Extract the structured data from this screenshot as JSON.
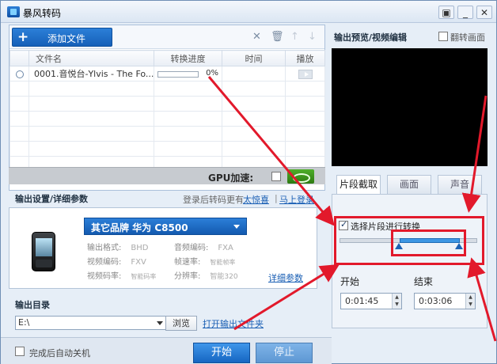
{
  "app": {
    "title": "暴风转码"
  },
  "window_controls": {
    "menu": "▣",
    "minimize": "_",
    "close": "✕"
  },
  "file_panel": {
    "add_label": "添加文件",
    "columns": [
      "",
      "文件名",
      "转换进度",
      "时间",
      "播放"
    ],
    "rows": [
      {
        "name": "0001.音悦台-Ylvis - The Fo...",
        "progress_text": "0%",
        "progress": 0,
        "time": ""
      }
    ],
    "gpu_label": "GPU加速:"
  },
  "output_settings": {
    "heading": "输出设置/详细参数",
    "login_text": "登录后转码更有",
    "login_link": "太惊喜",
    "login_now": "马上登录",
    "device": "其它品牌 华为 C8500",
    "params": [
      {
        "label": "输出格式:",
        "value": "BHD"
      },
      {
        "label": "音频编码:",
        "value": "FXA"
      },
      {
        "label": "视频编码:",
        "value": "FXV"
      },
      {
        "label": "帧速率:",
        "value": "智能帧率"
      },
      {
        "label": "视频码率:",
        "value": "智能码率"
      },
      {
        "label": "分辨率:",
        "value": "智能320"
      }
    ],
    "detail_link": "详细参数"
  },
  "output_dir": {
    "heading": "输出目录",
    "path": "E:\\",
    "browse": "浏览",
    "open_folder": "打开输出文件夹"
  },
  "bottom": {
    "auto_shutdown": "完成后自动关机",
    "start": "开始",
    "stop": "停止"
  },
  "preview": {
    "heading": "输出预览/视频编辑",
    "flip_label": "翻转画面",
    "tabs": [
      "片段截取",
      "画面",
      "声音"
    ],
    "segment_label": "选择片段进行转换",
    "segment_checked": true,
    "segment_start_fraction": 0.43,
    "segment_end_fraction": 0.87,
    "start_label": "开始",
    "end_label": "结束",
    "start_time": "0:01:45",
    "end_time": "0:03:06"
  },
  "colors": {
    "accent": "#1666c2",
    "annotation": "#e2192b"
  }
}
